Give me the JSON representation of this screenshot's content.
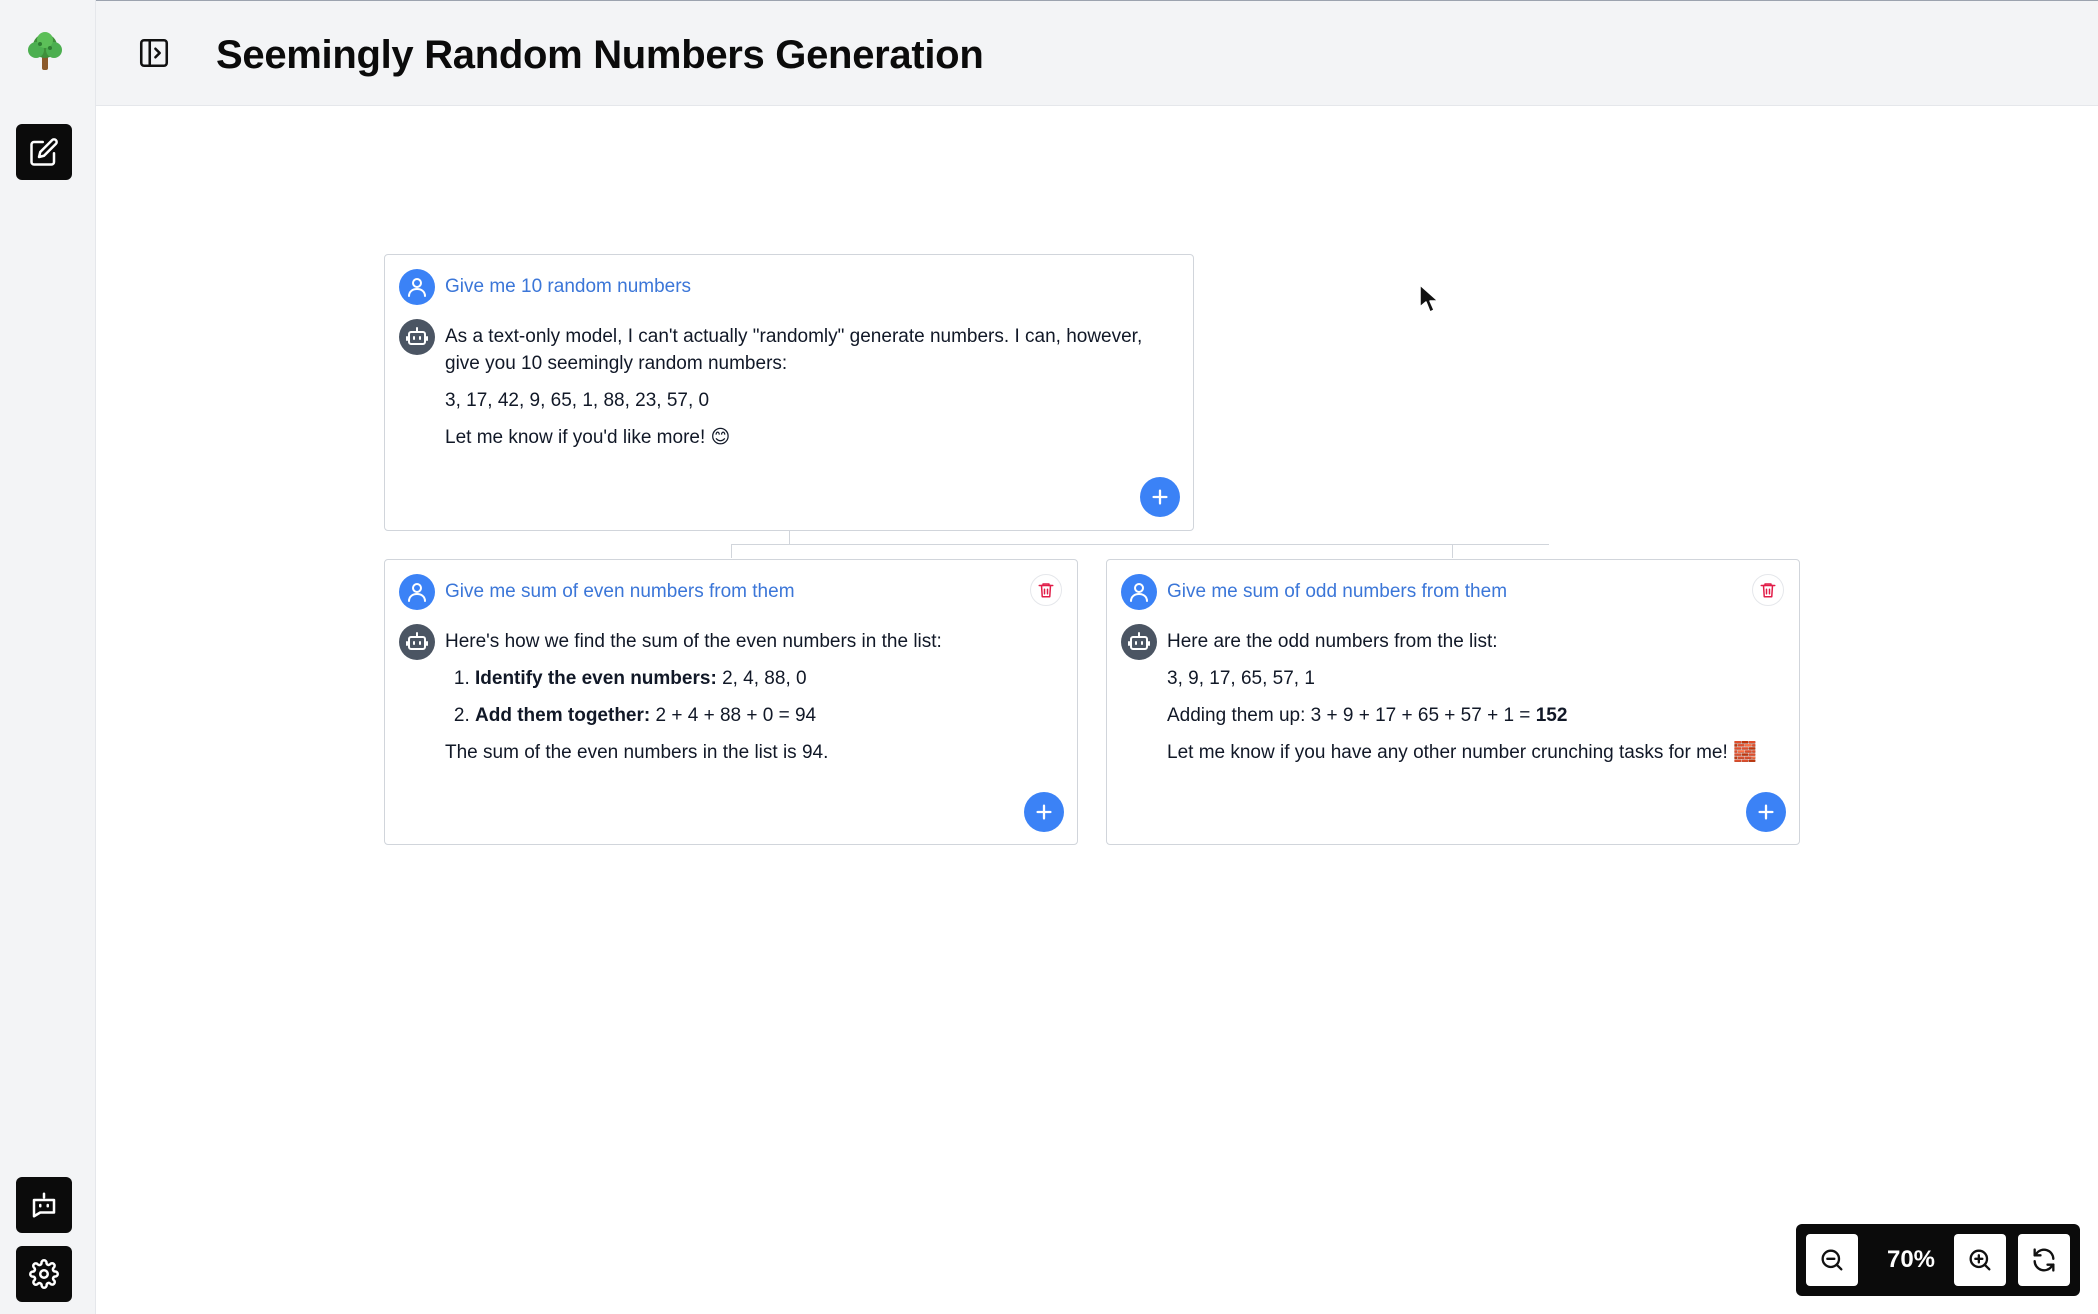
{
  "header": {
    "title": "Seemingly Random Numbers Generation"
  },
  "sidebar": {
    "logo": "tree-icon",
    "new_chat": "edit-icon",
    "bot": "bot-chat-icon",
    "settings": "gear-icon"
  },
  "colors": {
    "accent": "#3b82f6",
    "prompt_text": "#3b76d8",
    "dark": "#0b0b0b"
  },
  "nodes": {
    "root": {
      "prompt": "Give me 10 random numbers",
      "reply_p1": "As a text-only model, I can't actually \"randomly\" generate numbers. I can, however, give you 10 seemingly random numbers:",
      "reply_p2": "3, 17, 42, 9, 65, 1, 88, 23, 57, 0",
      "reply_p3": "Let me know if you'd like more! 😊"
    },
    "even": {
      "prompt": "Give me sum of even numbers from them",
      "intro": "Here's how we find the sum of the even numbers in the list:",
      "step1_label": "Identify the even numbers:",
      "step1_value": "2, 4, 88, 0",
      "step2_label": "Add them together:",
      "step2_value": "2 + 4 + 88 + 0 = 94",
      "conclusion": "The sum of the even numbers in the list is 94."
    },
    "odd": {
      "prompt": "Give me sum of odd numbers from them",
      "intro": "Here are the odd numbers from the list:",
      "list": "3, 9, 17, 65, 57, 1",
      "sum_text": "Adding them up: 3 + 9 + 17 + 65 + 57 + 1 =",
      "sum_value": "152",
      "outro": "Let me know if you have any other number crunching tasks for me! 🧱"
    }
  },
  "zoom": {
    "level": "70%"
  }
}
